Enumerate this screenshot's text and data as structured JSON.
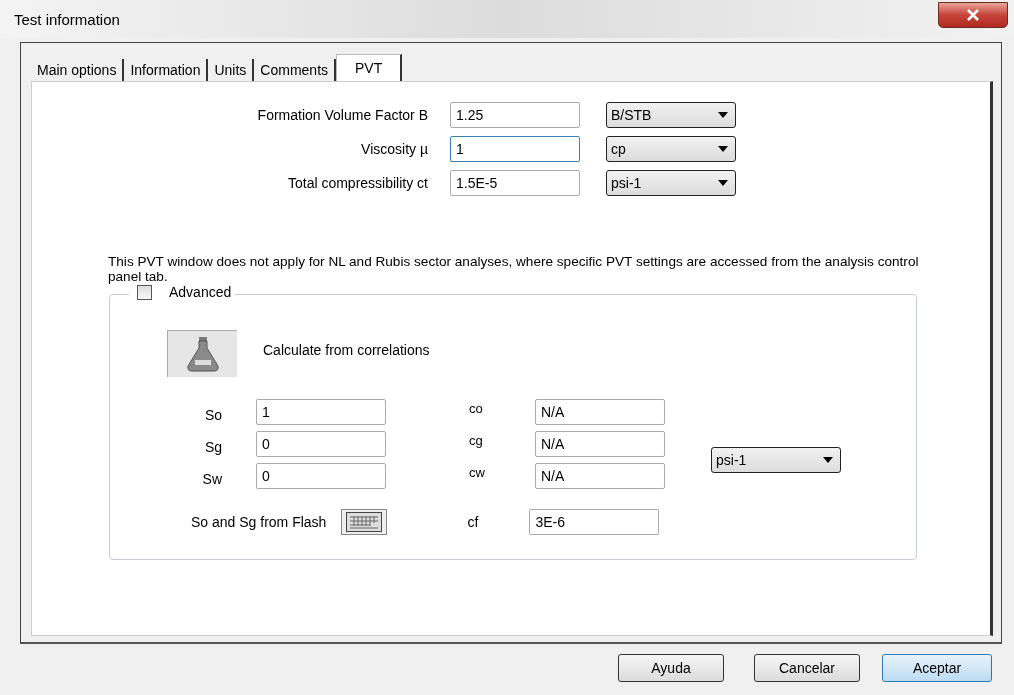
{
  "window": {
    "title": "Test information"
  },
  "tabs": [
    {
      "label": "Main options",
      "selected": false
    },
    {
      "label": "Information",
      "selected": false
    },
    {
      "label": "Units",
      "selected": false
    },
    {
      "label": "Comments",
      "selected": false
    },
    {
      "label": "PVT",
      "selected": true
    }
  ],
  "pvt_fields": [
    {
      "label": "Formation Volume Factor B",
      "value": "1.25",
      "unit": "B/STB",
      "focused": false
    },
    {
      "label": "Viscosity µ",
      "value": "1",
      "unit": "cp",
      "focused": true
    },
    {
      "label": "Total compressibility ct",
      "value": "1.5E-5",
      "unit": "psi-1",
      "focused": false
    }
  ],
  "note": "This PVT window does not apply for NL and Rubis sector analyses, where specific PVT settings are accessed from the analysis control panel tab.",
  "advanced": {
    "label": "Advanced",
    "checked": false
  },
  "calculate_label": "Calculate from correlations",
  "saturations": [
    {
      "label": "So",
      "value": "1"
    },
    {
      "label": "Sg",
      "value": "0"
    },
    {
      "label": "Sw",
      "value": "0"
    }
  ],
  "compressibilities": [
    {
      "label": "co",
      "value": "N/A"
    },
    {
      "label": "cg",
      "value": "N/A"
    },
    {
      "label": "cw",
      "value": "N/A"
    }
  ],
  "compressibility_unit": "psi-1",
  "flash_label": "So and Sg from Flash",
  "cf": {
    "label": "cf",
    "value": "3E-6"
  },
  "buttons": [
    {
      "label": "Ayuda",
      "default": false
    },
    {
      "label": "Cancelar",
      "default": false
    },
    {
      "label": "Aceptar",
      "default": true
    }
  ]
}
